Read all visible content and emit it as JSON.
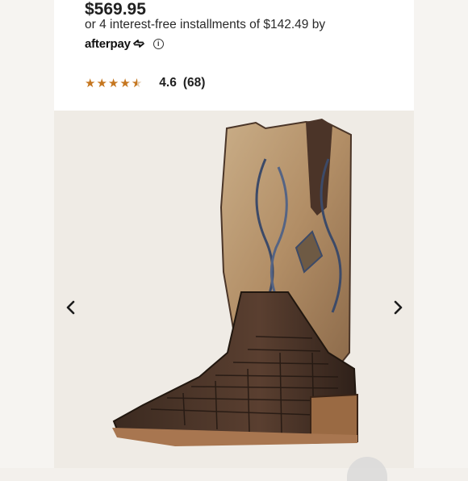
{
  "product": {
    "price": "$569.95",
    "installments_text": "or 4 interest-free installments of $142.49 by",
    "afterpay_label": "afterpay",
    "rating_value": "4.6",
    "review_count": "(68)",
    "star_rating": 4.5
  },
  "colors": {
    "star": "#c5761f",
    "hero_bg": "#efebe5"
  },
  "icons": {
    "prev": "chevron-left-icon",
    "next": "chevron-right-icon",
    "info": "info-icon",
    "afterpay": "afterpay-arrows-icon"
  }
}
